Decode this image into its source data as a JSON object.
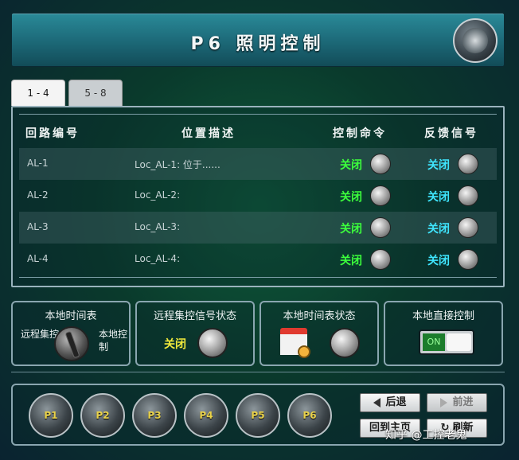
{
  "title": "P6 照明控制",
  "tabs": [
    {
      "label": "1 - 4"
    },
    {
      "label": "5 - 8"
    }
  ],
  "table": {
    "headers": [
      "回路编号",
      "位置描述",
      "控制命令",
      "反馈信号"
    ],
    "rows": [
      {
        "id": "AL-1",
        "desc": "Loc_AL-1: 位于......",
        "cmd": "关闭",
        "fb": "关闭"
      },
      {
        "id": "AL-2",
        "desc": "Loc_AL-2:",
        "cmd": "关闭",
        "fb": "关闭"
      },
      {
        "id": "AL-3",
        "desc": "Loc_AL-3:",
        "cmd": "关闭",
        "fb": "关闭"
      },
      {
        "id": "AL-4",
        "desc": "Loc_AL-4:",
        "cmd": "关闭",
        "fb": "关闭"
      }
    ]
  },
  "boxes": {
    "local_schedule": {
      "title": "本地时间表",
      "left": "远程集控",
      "right": "本地控制"
    },
    "remote_status": {
      "title": "远程集控信号状态",
      "value": "关闭"
    },
    "schedule_status": {
      "title": "本地时间表状态"
    },
    "direct_control": {
      "title": "本地直接控制",
      "toggle": "ON"
    }
  },
  "pages": [
    "P1",
    "P2",
    "P3",
    "P4",
    "P5",
    "P6"
  ],
  "nav": {
    "back": "后退",
    "forward": "前进",
    "home": "回到主页",
    "refresh": "刷新"
  },
  "watermark": "知乎 @工控老鬼"
}
